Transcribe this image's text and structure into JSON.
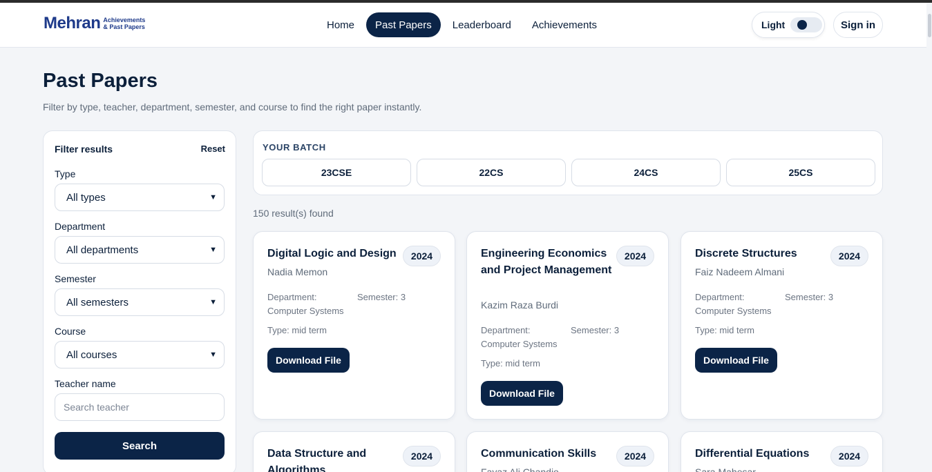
{
  "header": {
    "logo_main": "Mehran",
    "logo_sub_line1": "Achievements",
    "logo_sub_line2": "& Past Papers",
    "nav": [
      "Home",
      "Past Papers",
      "Leaderboard",
      "Achievements"
    ],
    "active_nav": "Past Papers",
    "theme_label": "Light",
    "signin_label": "Sign in"
  },
  "page": {
    "title": "Past Papers",
    "subtitle": "Filter by type, teacher, department, semester, and course to find the right paper instantly."
  },
  "filters": {
    "title": "Filter results",
    "reset_label": "Reset",
    "type_label": "Type",
    "type_value": "All types",
    "department_label": "Department",
    "department_value": "All departments",
    "semester_label": "Semester",
    "semester_value": "All semesters",
    "course_label": "Course",
    "course_value": "All courses",
    "teacher_label": "Teacher name",
    "teacher_placeholder": "Search teacher",
    "search_label": "Search"
  },
  "batch": {
    "label": "YOUR BATCH",
    "options": [
      "23CSE",
      "22CS",
      "24CS",
      "25CS"
    ]
  },
  "results": {
    "count_text": "150 result(s) found",
    "cards": [
      {
        "title": "Digital Logic and Design",
        "year": "2024",
        "teacher": "Nadia Memon",
        "department": "Department: Computer Systems",
        "semester": "Semester: 3",
        "type": "Type: mid term",
        "download": "Download File"
      },
      {
        "title": "Engineering Economics and Project Management",
        "year": "2024",
        "teacher": "Kazim Raza Burdi",
        "department": "Department: Computer Systems",
        "semester": "Semester: 3",
        "type": "Type: mid term",
        "download": "Download File"
      },
      {
        "title": "Discrete Structures",
        "year": "2024",
        "teacher": "Faiz Nadeem Almani",
        "department": "Department: Computer Systems",
        "semester": "Semester: 3",
        "type": "Type: mid term",
        "download": "Download File"
      },
      {
        "title": "Data Structure and Algorithms",
        "year": "2024",
        "teacher": ""
      },
      {
        "title": "Communication Skills",
        "year": "2024",
        "teacher": "Fayaz Ali Chandio"
      },
      {
        "title": "Differential Equations",
        "year": "2024",
        "teacher": "Sara Mahesar"
      }
    ]
  }
}
